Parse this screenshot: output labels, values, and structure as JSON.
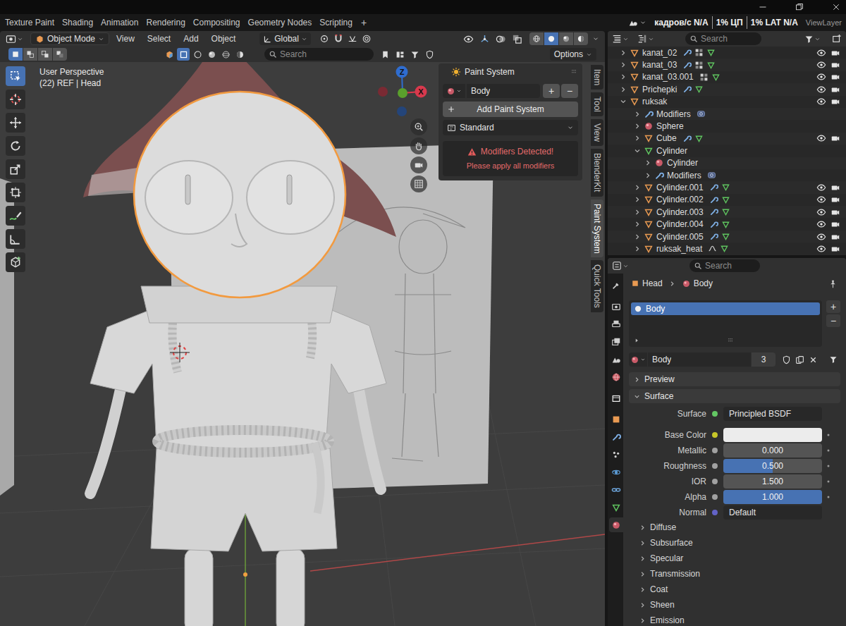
{
  "topbar": {
    "workspaces": [
      {
        "label": "Texture Paint",
        "selected": false
      },
      {
        "label": "Shading",
        "selected": false
      },
      {
        "label": "Animation",
        "selected": false
      },
      {
        "label": "Rendering",
        "selected": false
      },
      {
        "label": "Compositing",
        "selected": false
      },
      {
        "label": "Geometry Nodes",
        "selected": false
      },
      {
        "label": "Scripting",
        "selected": false
      }
    ],
    "add_workspace": "+",
    "stats": [
      "кадров/с N/A",
      "1% ЦП",
      "1% LAT N/A"
    ],
    "view_layer": "ViewLayer"
  },
  "viewport": {
    "mode": "Object Mode",
    "menus": [
      "View",
      "Select",
      "Add",
      "Object"
    ],
    "orientation": "Global",
    "shading_modes": [
      {
        "kind": "wireframe",
        "selected": false
      },
      {
        "kind": "solid",
        "selected": true
      },
      {
        "kind": "material",
        "selected": false
      },
      {
        "kind": "rendered",
        "selected": false
      }
    ],
    "select_modes": [
      {
        "kind": "new",
        "selected": true
      },
      {
        "kind": "extend",
        "selected": false
      },
      {
        "kind": "subtract",
        "selected": false
      },
      {
        "kind": "invert",
        "selected": false
      }
    ],
    "addon_buttons": [
      {
        "kind": "cube",
        "selected": false
      },
      {
        "kind": "frame",
        "selected": true
      },
      {
        "kind": "sphere",
        "selected": false
      },
      {
        "kind": "globe",
        "selected": false
      },
      {
        "kind": "orbit",
        "selected": false
      },
      {
        "kind": "half",
        "selected": false
      }
    ],
    "search": {
      "placeholder": "Search"
    },
    "options": "Options",
    "view_name": "User Perspective",
    "info": "(22) REF | Head",
    "tools": [
      {
        "kind": "select",
        "selected": true
      },
      {
        "kind": "cursor",
        "selected": false
      },
      {
        "kind": "move",
        "selected": false
      },
      {
        "kind": "rotate",
        "selected": false
      },
      {
        "kind": "scale",
        "selected": false
      },
      {
        "kind": "transform",
        "selected": false
      },
      {
        "kind": "annotate",
        "selected": false
      },
      {
        "kind": "measure",
        "selected": false
      },
      {
        "kind": "add_cube",
        "selected": false
      }
    ],
    "gizmo": [
      {
        "label": "Z",
        "color": "#2f6dd0"
      },
      {
        "label": "X",
        "color": "#d8394d"
      }
    ],
    "sidebar_tabs": [
      {
        "label": "Item",
        "selected": false
      },
      {
        "label": "Tool",
        "selected": false
      },
      {
        "label": "View",
        "selected": false
      },
      {
        "label": "BlenderKit",
        "selected": false
      },
      {
        "label": "Paint System",
        "selected": true
      },
      {
        "label": "Quick Tools",
        "selected": false
      }
    ]
  },
  "paint_system": {
    "title": "Paint System",
    "material": "Body",
    "add": "+",
    "remove": "−",
    "add_button": "Add Paint System",
    "preset": "Standard",
    "warning": {
      "title": "Modifiers Detected!",
      "message": "Please apply all modifiers"
    }
  },
  "outliner": {
    "search": {
      "placeholder": "Search"
    },
    "rows": [
      {
        "name": "kanat_02",
        "level": 0,
        "kind": "object",
        "expanded": false,
        "extras": [
          "modifier",
          "vertex_groups",
          "mesh"
        ],
        "toggles": true
      },
      {
        "name": "kanat_03",
        "level": 0,
        "kind": "object",
        "expanded": false,
        "extras": [
          "modifier",
          "vertex_groups",
          "mesh"
        ],
        "toggles": true
      },
      {
        "name": "kanat_03.001",
        "level": 0,
        "kind": "object",
        "expanded": false,
        "extras": [
          "vertex_groups",
          "mesh"
        ],
        "toggles": true
      },
      {
        "name": "Prichepki",
        "level": 0,
        "kind": "object",
        "expanded": false,
        "extras": [
          "modifier",
          "mesh"
        ],
        "toggles": true
      },
      {
        "name": "ruksak",
        "level": 0,
        "kind": "object",
        "expanded": true,
        "extras": [],
        "toggles": true
      },
      {
        "name": "Modifiers",
        "level": 1,
        "kind": "modifier",
        "expanded": false,
        "extras": [
          "modifier_stack"
        ],
        "toggles": false
      },
      {
        "name": "Sphere",
        "level": 1,
        "kind": "material",
        "expanded": false,
        "extras": [],
        "toggles": false
      },
      {
        "name": "Cube",
        "level": 1,
        "kind": "object",
        "expanded": false,
        "extras": [
          "modifier",
          "mesh"
        ],
        "toggles": true
      },
      {
        "name": "Cylinder",
        "level": 1,
        "kind": "mesh",
        "expanded": true,
        "extras": [],
        "toggles": false
      },
      {
        "name": "Cylinder",
        "level": 2,
        "kind": "material",
        "expanded": false,
        "extras": [],
        "toggles": false
      },
      {
        "name": "Modifiers",
        "level": 2,
        "kind": "modifier",
        "expanded": false,
        "extras": [
          "modifier_stack"
        ],
        "toggles": false
      },
      {
        "name": "Cylinder.001",
        "level": 1,
        "kind": "object",
        "expanded": false,
        "extras": [
          "modifier",
          "mesh"
        ],
        "toggles": true
      },
      {
        "name": "Cylinder.002",
        "level": 1,
        "kind": "object",
        "expanded": false,
        "extras": [
          "modifier",
          "mesh"
        ],
        "toggles": true
      },
      {
        "name": "Cylinder.003",
        "level": 1,
        "kind": "object",
        "expanded": false,
        "extras": [
          "modifier",
          "mesh"
        ],
        "toggles": true
      },
      {
        "name": "Cylinder.004",
        "level": 1,
        "kind": "object",
        "expanded": false,
        "extras": [
          "modifier",
          "mesh"
        ],
        "toggles": true
      },
      {
        "name": "Cylinder.005",
        "level": 1,
        "kind": "object",
        "expanded": false,
        "extras": [
          "modifier",
          "mesh"
        ],
        "toggles": true
      },
      {
        "name": "ruksak_heat",
        "level": 1,
        "kind": "object",
        "expanded": false,
        "extras": [
          "hook",
          "mesh"
        ],
        "toggles": true
      }
    ]
  },
  "properties": {
    "search": {
      "placeholder": "Search"
    },
    "tabs": [
      {
        "kind": "tool",
        "selected": false
      },
      {
        "kind": "render",
        "selected": false
      },
      {
        "kind": "output",
        "selected": false
      },
      {
        "kind": "view_layer",
        "selected": false
      },
      {
        "kind": "scene",
        "selected": false
      },
      {
        "kind": "world",
        "selected": false
      },
      {
        "kind": "collection",
        "selected": false
      },
      {
        "kind": "object",
        "selected": false
      },
      {
        "kind": "modifiers",
        "selected": false
      },
      {
        "kind": "particles",
        "selected": false
      },
      {
        "kind": "physics",
        "selected": false
      },
      {
        "kind": "constraints",
        "selected": false
      },
      {
        "kind": "data",
        "selected": false
      },
      {
        "kind": "material",
        "selected": true
      }
    ],
    "breadcrumb": [
      "Head",
      "Body"
    ],
    "slots": [
      {
        "label": "Body",
        "selected": true
      }
    ],
    "slot_add": "+",
    "slot_remove": "−",
    "material": {
      "name": "Body",
      "users": "3"
    },
    "panels": [
      {
        "label": "Preview",
        "expanded": false
      },
      {
        "label": "Surface",
        "expanded": true
      }
    ],
    "surface": {
      "label": "Surface",
      "shader": "Principled BSDF",
      "color": "#63c763"
    },
    "inputs": [
      {
        "label": "Base Color",
        "kind": "color",
        "color": "#c7c729",
        "swatch": "#ececec"
      },
      {
        "label": "Metallic",
        "kind": "slider",
        "value": "0.000",
        "level": 0,
        "color": "#a1a1a1"
      },
      {
        "label": "Roughness",
        "kind": "slider",
        "value": "0.500",
        "level": 0.5,
        "color": "#a1a1a1"
      },
      {
        "label": "IOR",
        "kind": "number",
        "value": "1.500",
        "color": "#a1a1a1"
      },
      {
        "label": "Alpha",
        "kind": "slider",
        "value": "1.000",
        "level": 1,
        "color": "#a1a1a1"
      },
      {
        "label": "Normal",
        "kind": "link",
        "value": "Default",
        "color": "#6363c7"
      }
    ],
    "subpanels": [
      {
        "label": "Diffuse",
        "expanded": false
      },
      {
        "label": "Subsurface",
        "expanded": false
      },
      {
        "label": "Specular",
        "expanded": false
      },
      {
        "label": "Transmission",
        "expanded": false
      },
      {
        "label": "Coat",
        "expanded": false
      },
      {
        "label": "Sheen",
        "expanded": false
      },
      {
        "label": "Emission",
        "expanded": false
      }
    ]
  }
}
